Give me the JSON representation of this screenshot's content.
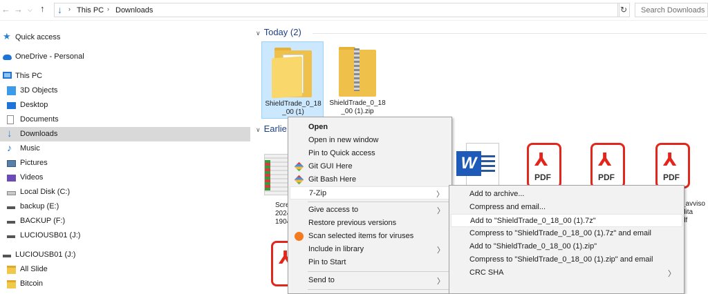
{
  "address": {
    "crumbs": [
      "This PC",
      "Downloads"
    ],
    "search_placeholder": "Search Downloads"
  },
  "nav": {
    "quick_access": "Quick access",
    "onedrive": "OneDrive - Personal",
    "this_pc": "This PC",
    "items": [
      "3D Objects",
      "Desktop",
      "Documents",
      "Downloads",
      "Music",
      "Pictures",
      "Videos",
      "Local Disk (C:)",
      "backup (E:)",
      "BACKUP (F:)",
      "LUCIOUSB01 (J:)"
    ],
    "usb": "LUCIOUSB01 (J:)",
    "usb_children": [
      "All Slide",
      "Bitcoin"
    ]
  },
  "content": {
    "group_today": "Today (2)",
    "group_earlier": "Earlie",
    "file1_line1": "ShieldTrade_0_18",
    "file1_line2": "_00 (1)",
    "file2_line1": "ShieldTrade_0_18",
    "file2_line2": "_00 (1).zip",
    "pdf_label": "PDF",
    "partial1": [
      "Scre",
      "2024",
      "1904"
    ],
    "partial2": [
      "_avviso",
      "dita",
      "df"
    ]
  },
  "context_menu": {
    "open": "Open",
    "open_new_window": "Open in new window",
    "pin_quick": "Pin to Quick access",
    "git_gui": "Git GUI Here",
    "git_bash": "Git Bash Here",
    "seven_zip": "7-Zip",
    "give_access": "Give access to",
    "restore": "Restore previous versions",
    "scan": "Scan selected items for viruses",
    "include_library": "Include in library",
    "pin_start": "Pin to Start",
    "send_to": "Send to"
  },
  "submenu": {
    "items": [
      "Add to archive...",
      "Compress and email...",
      "Add to \"ShieldTrade_0_18_00 (1).7z\"",
      "Compress to \"ShieldTrade_0_18_00 (1).7z\" and email",
      "Add to \"ShieldTrade_0_18_00 (1).zip\"",
      "Compress to \"ShieldTrade_0_18_00 (1).zip\" and email",
      "CRC SHA"
    ]
  }
}
